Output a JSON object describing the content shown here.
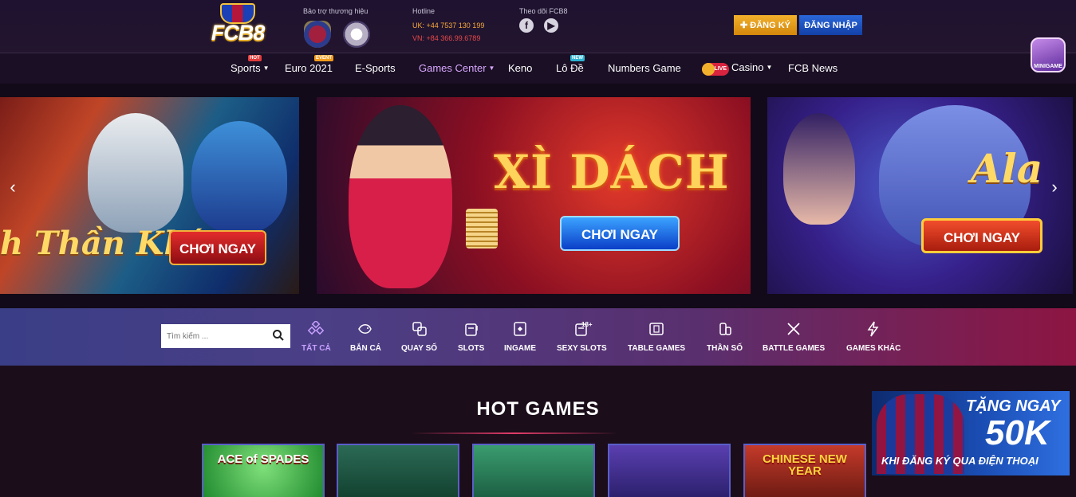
{
  "header": {
    "logo_text": "FCB8",
    "sponsor_label": "Bảo trợ thương hiệu",
    "hotline": {
      "label": "Hotline",
      "uk": "UK: +44 7537 130 199",
      "vn": "VN: +84 366.99.6789"
    },
    "follow_label": "Theo dõi FCB8",
    "register_label": "ĐĂNG KÝ",
    "login_label": "ĐĂNG NHẬP",
    "minigame_label": "MINIGAME"
  },
  "nav": {
    "items": [
      {
        "label": "Sports",
        "badge": "HOT",
        "dropdown": true
      },
      {
        "label": "Euro 2021",
        "badge": "EVENT"
      },
      {
        "label": "E-Sports"
      },
      {
        "label": "Games Center",
        "dropdown": true,
        "active": true
      },
      {
        "label": "Keno"
      },
      {
        "label": "Lô Đề",
        "badge": "NEW"
      },
      {
        "label": "Numbers Game"
      },
      {
        "label": "Casino",
        "live": "LIVE",
        "dropdown": true
      },
      {
        "label": "FCB News"
      }
    ]
  },
  "banner": {
    "slides": [
      {
        "script": "h Thần Khí",
        "button": "CHƠI NGAY"
      },
      {
        "title": "XÌ DÁCH",
        "button": "CHƠI NGAY"
      },
      {
        "script": "Ala",
        "button": "CHƠI NGAY"
      }
    ],
    "prev_arrow": "‹",
    "next_arrow": "›"
  },
  "search": {
    "placeholder": "Tìm kiếm ..."
  },
  "categories": [
    {
      "label": "TẤT CẢ",
      "active": true,
      "icon": "all-games-icon"
    },
    {
      "label": "BẮN CÁ",
      "icon": "fish-icon"
    },
    {
      "label": "QUAY SỐ",
      "icon": "lottery-icon"
    },
    {
      "label": "SLOTS",
      "icon": "slot-machine-icon"
    },
    {
      "label": "INGAME",
      "icon": "ingame-icon"
    },
    {
      "label": "SEXY SLOTS",
      "icon": "sexy-slots-icon",
      "badge": "18+"
    },
    {
      "label": "TABLE GAMES",
      "icon": "cards-icon"
    },
    {
      "label": "THẦN SỐ",
      "icon": "coins-icon"
    },
    {
      "label": "BATTLE GAMES",
      "icon": "swords-icon"
    },
    {
      "label": "GAMES KHÁC",
      "icon": "lightning-icon"
    }
  ],
  "hot_games": {
    "title": "HOT GAMES",
    "games": [
      {
        "title": "ACE of SPADES"
      },
      {
        "title": ""
      },
      {
        "title": ""
      },
      {
        "title": ""
      },
      {
        "title": "CHINESE NEW YEAR"
      }
    ]
  },
  "promo": {
    "title": "TẶNG NGAY",
    "amount": "50K",
    "subtitle": "KHI ĐĂNG KÝ QUA ĐIỆN THOẠI"
  },
  "colors": {
    "accent_purple": "#d9a8ff",
    "register": "#f2b12c",
    "login": "#1c52c4",
    "hotline_uk": "#f7a93b",
    "hotline_vn": "#e74a4a"
  }
}
